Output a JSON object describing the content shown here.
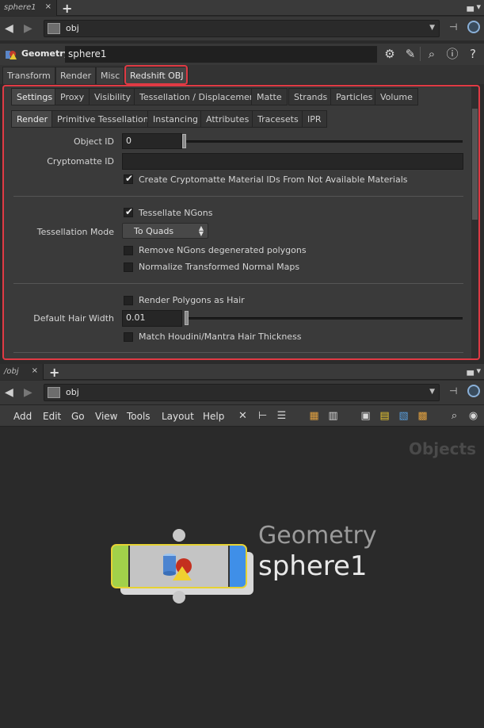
{
  "top_tab": {
    "label": "sphere1",
    "close": "×"
  },
  "top_path": {
    "text": "obj"
  },
  "geometry_header": {
    "type_label": "Geometry",
    "node_name": "sphere1"
  },
  "main_tabs": [
    "Transform",
    "Render",
    "Misc",
    "Redshift OBJ"
  ],
  "redshift_tabs": [
    "Settings",
    "Proxy",
    "Visibility",
    "Tessellation / Displacement",
    "Matte",
    "Strands",
    "Particles",
    "Volume"
  ],
  "settings_tabs": [
    "Render",
    "Primitive Tessellation",
    "Instancing",
    "Attributes",
    "Tracesets",
    "IPR"
  ],
  "params": {
    "object_id": {
      "label": "Object ID",
      "value": "0"
    },
    "cryptomatte_id": {
      "label": "Cryptomatte ID",
      "value": ""
    },
    "create_cryptomatte": {
      "label": "Create Cryptomatte Material IDs From Not Available Materials",
      "checked": true
    },
    "tessellate_ngons": {
      "label": "Tessellate NGons",
      "checked": true
    },
    "tessellation_mode": {
      "label": "Tessellation Mode",
      "value": "To Quads"
    },
    "remove_ngons": {
      "label": "Remove NGons degenerated polygons",
      "checked": false
    },
    "normalize_maps": {
      "label": "Normalize Transformed Normal Maps",
      "checked": false
    },
    "render_as_hair": {
      "label": "Render Polygons as Hair",
      "checked": false
    },
    "hair_width": {
      "label": "Default Hair Width",
      "value": "0.01"
    },
    "match_hair": {
      "label": "Match Houdini/Mantra Hair Thickness",
      "checked": false
    }
  },
  "bottom_tab": {
    "label": "/obj",
    "close": "×"
  },
  "bottom_path": {
    "text": "obj"
  },
  "network_menu": [
    "Add",
    "Edit",
    "Go",
    "View",
    "Tools",
    "Layout",
    "Help"
  ],
  "network": {
    "context_label": "Objects",
    "node_type": "Geometry",
    "node_name": "sphere1"
  },
  "colors": {
    "highlight": "#e03a44",
    "node_left": "#a2d14a",
    "node_right": "#3f8fe8",
    "node_border": "#e6d233"
  }
}
